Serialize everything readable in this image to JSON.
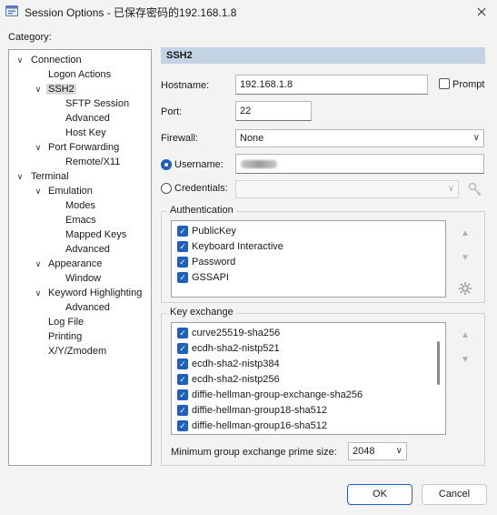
{
  "window": {
    "title": "Session Options - 已保存密码的192.168.1.8"
  },
  "category": {
    "label": "Category:",
    "items": [
      {
        "label": "Connection",
        "toggle": "∨"
      },
      {
        "label": "Logon Actions"
      },
      {
        "label": "SSH2",
        "toggle": "∨",
        "selected": true
      },
      {
        "label": "SFTP Session"
      },
      {
        "label": "Advanced"
      },
      {
        "label": "Host Key"
      },
      {
        "label": "Port Forwarding",
        "toggle": "∨"
      },
      {
        "label": "Remote/X11"
      },
      {
        "label": "Terminal",
        "toggle": "∨"
      },
      {
        "label": "Emulation",
        "toggle": "∨"
      },
      {
        "label": "Modes"
      },
      {
        "label": "Emacs"
      },
      {
        "label": "Mapped Keys"
      },
      {
        "label": "Advanced"
      },
      {
        "label": "Appearance",
        "toggle": "∨"
      },
      {
        "label": "Window"
      },
      {
        "label": "Keyword Highlighting",
        "toggle": "∨"
      },
      {
        "label": "Advanced"
      },
      {
        "label": "Log File"
      },
      {
        "label": "Printing"
      },
      {
        "label": "X/Y/Zmodem"
      }
    ]
  },
  "ssh2": {
    "header": "SSH2",
    "hostname_label": "Hostname:",
    "hostname_value": "192.168.1.8",
    "prompt_label": "Prompt",
    "prompt_checked": false,
    "port_label": "Port:",
    "port_value": "22",
    "firewall_label": "Firewall:",
    "firewall_value": "None",
    "username_label": "Username:",
    "username_selected": true,
    "credentials_label": "Credentials:",
    "credentials_selected": false
  },
  "authentication": {
    "title": "Authentication",
    "items": [
      {
        "label": "PublicKey",
        "checked": true
      },
      {
        "label": "Keyboard Interactive",
        "checked": true
      },
      {
        "label": "Password",
        "checked": true
      },
      {
        "label": "GSSAPI",
        "checked": true
      }
    ]
  },
  "key_exchange": {
    "title": "Key exchange",
    "items": [
      {
        "label": "curve25519-sha256",
        "checked": true
      },
      {
        "label": "ecdh-sha2-nistp521",
        "checked": true
      },
      {
        "label": "ecdh-sha2-nistp384",
        "checked": true
      },
      {
        "label": "ecdh-sha2-nistp256",
        "checked": true
      },
      {
        "label": "diffie-hellman-group-exchange-sha256",
        "checked": true
      },
      {
        "label": "diffie-hellman-group18-sha512",
        "checked": true
      },
      {
        "label": "diffie-hellman-group16-sha512",
        "checked": true
      }
    ],
    "min_prime_label": "Minimum group exchange prime size:",
    "min_prime_value": "2048"
  },
  "buttons": {
    "ok": "OK",
    "cancel": "Cancel"
  },
  "colors": {
    "accent": "#1f5fbf",
    "header_bg": "#c5d4e5"
  },
  "icons": {
    "app": "terminal-app-icon",
    "close": "close-icon",
    "up": "arrow-up-icon",
    "down": "arrow-down-icon",
    "settings": "gear-icon",
    "key": "key-icon"
  }
}
